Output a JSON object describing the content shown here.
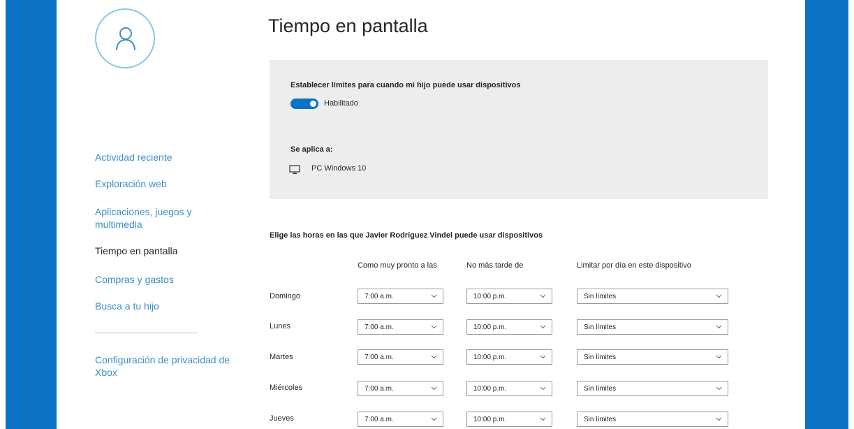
{
  "page": {
    "title": "Tiempo en pantalla"
  },
  "sidebar": {
    "avatar_icon": "person-icon",
    "items": [
      {
        "label": "Actividad reciente",
        "active": false
      },
      {
        "label": "Exploración web",
        "active": false
      },
      {
        "label": "Aplicaciones, juegos y multimedia",
        "active": false
      },
      {
        "label": "Tiempo en pantalla",
        "active": true
      },
      {
        "label": "Compras y gastos",
        "active": false
      },
      {
        "label": "Busca a tu hijo",
        "active": false
      }
    ],
    "privacy_link": "Configuración de privacidad de Xbox"
  },
  "limits_panel": {
    "heading": "Establecer límites para cuando mi hijo puede usar dispositivos",
    "toggle_state": "on",
    "toggle_label": "Habilitado",
    "applies_label": "Se aplica a:",
    "device_icon": "monitor-icon",
    "device_name": "PC Windows 10"
  },
  "schedule": {
    "heading": "Elige las horas en las que Javier Rodriguez Vindel puede usar dispositivos",
    "columns": {
      "earliest": "Como muy pronto a las",
      "latest": "No más tarde de",
      "limit": "Limitar por día en este dispositivo"
    },
    "rows": [
      {
        "day": "Domingo",
        "earliest": "7:00 a.m.",
        "latest": "10:00 p.m.",
        "limit": "Sin límites"
      },
      {
        "day": "Lunes",
        "earliest": "7:00 a.m.",
        "latest": "10:00 p.m.",
        "limit": "Sin límites"
      },
      {
        "day": "Martes",
        "earliest": "7:00 a.m.",
        "latest": "10:00 p.m.",
        "limit": "Sin límites"
      },
      {
        "day": "Miércoles",
        "earliest": "7:00 a.m.",
        "latest": "10:00 p.m.",
        "limit": "Sin límites"
      },
      {
        "day": "Jueves",
        "earliest": "7:00 a.m.",
        "latest": "10:00 p.m.",
        "limit": "Sin límites"
      }
    ]
  },
  "colors": {
    "accent": "#0b72c4",
    "link": "#3b8ec9",
    "panel_bg": "#ededed"
  }
}
